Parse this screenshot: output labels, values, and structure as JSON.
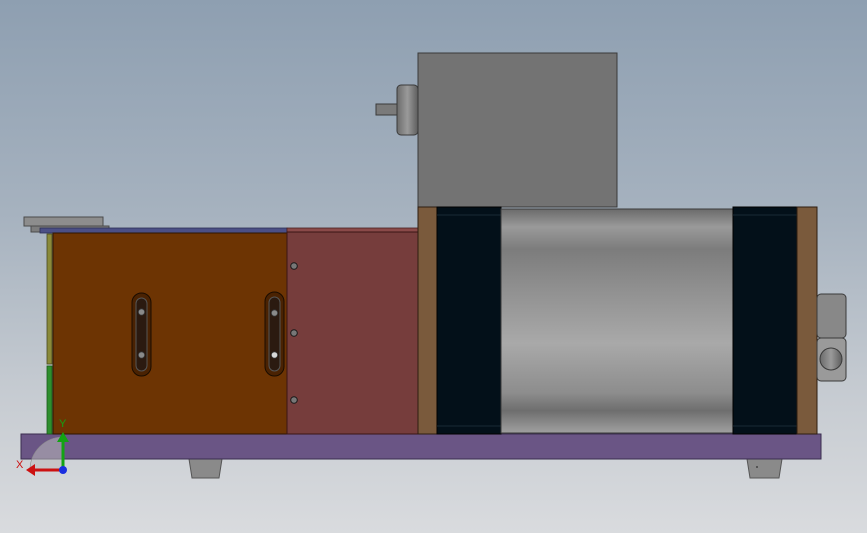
{
  "viewport": {
    "background_top": "#8e9fb1",
    "background_bottom": "#d9dbde"
  },
  "model": {
    "base_plate_color": "#6a5585",
    "box_brown_color": "#6d3403",
    "box_red_color": "#763d3c",
    "roller_dark_color": "#031019",
    "frame_side_color": "#7a5a3c",
    "motor_color": "#737373"
  },
  "triad": {
    "x_label": "X",
    "y_label": "Y",
    "x_color": "#cc1111",
    "y_color": "#13a313",
    "z_color": "#1a2ee0"
  }
}
